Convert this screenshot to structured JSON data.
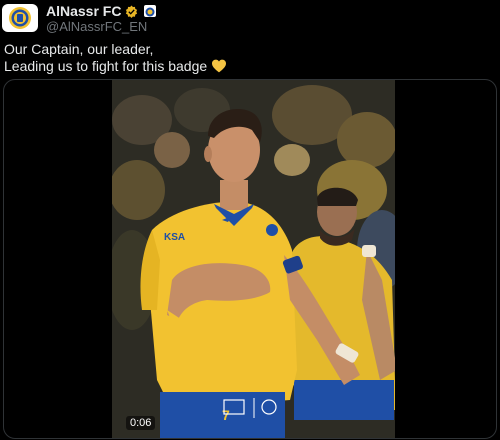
{
  "account": {
    "display_name": "AlNassr FC",
    "handle": "@AlNassrFC_EN"
  },
  "tweet": {
    "line1": "Our Captain, our leader,",
    "line2": "Leading us to fight for this badge"
  },
  "media": {
    "timestamp": "0:06"
  },
  "colors": {
    "kit_yellow": "#f2c230",
    "kit_blue": "#1f4fa6",
    "verified_gold": "#e8b525",
    "heart_yellow": "#f5c443"
  }
}
